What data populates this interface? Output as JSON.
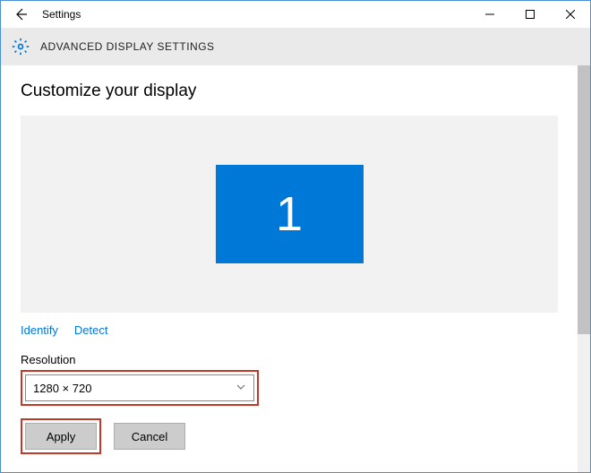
{
  "window": {
    "title": "Settings"
  },
  "header": {
    "title": "ADVANCED DISPLAY SETTINGS"
  },
  "page": {
    "heading": "Customize your display",
    "monitor_number": "1",
    "links": {
      "identify": "Identify",
      "detect": "Detect"
    },
    "resolution_label": "Resolution",
    "resolution_value": "1280 × 720",
    "buttons": {
      "apply": "Apply",
      "cancel": "Cancel"
    }
  }
}
